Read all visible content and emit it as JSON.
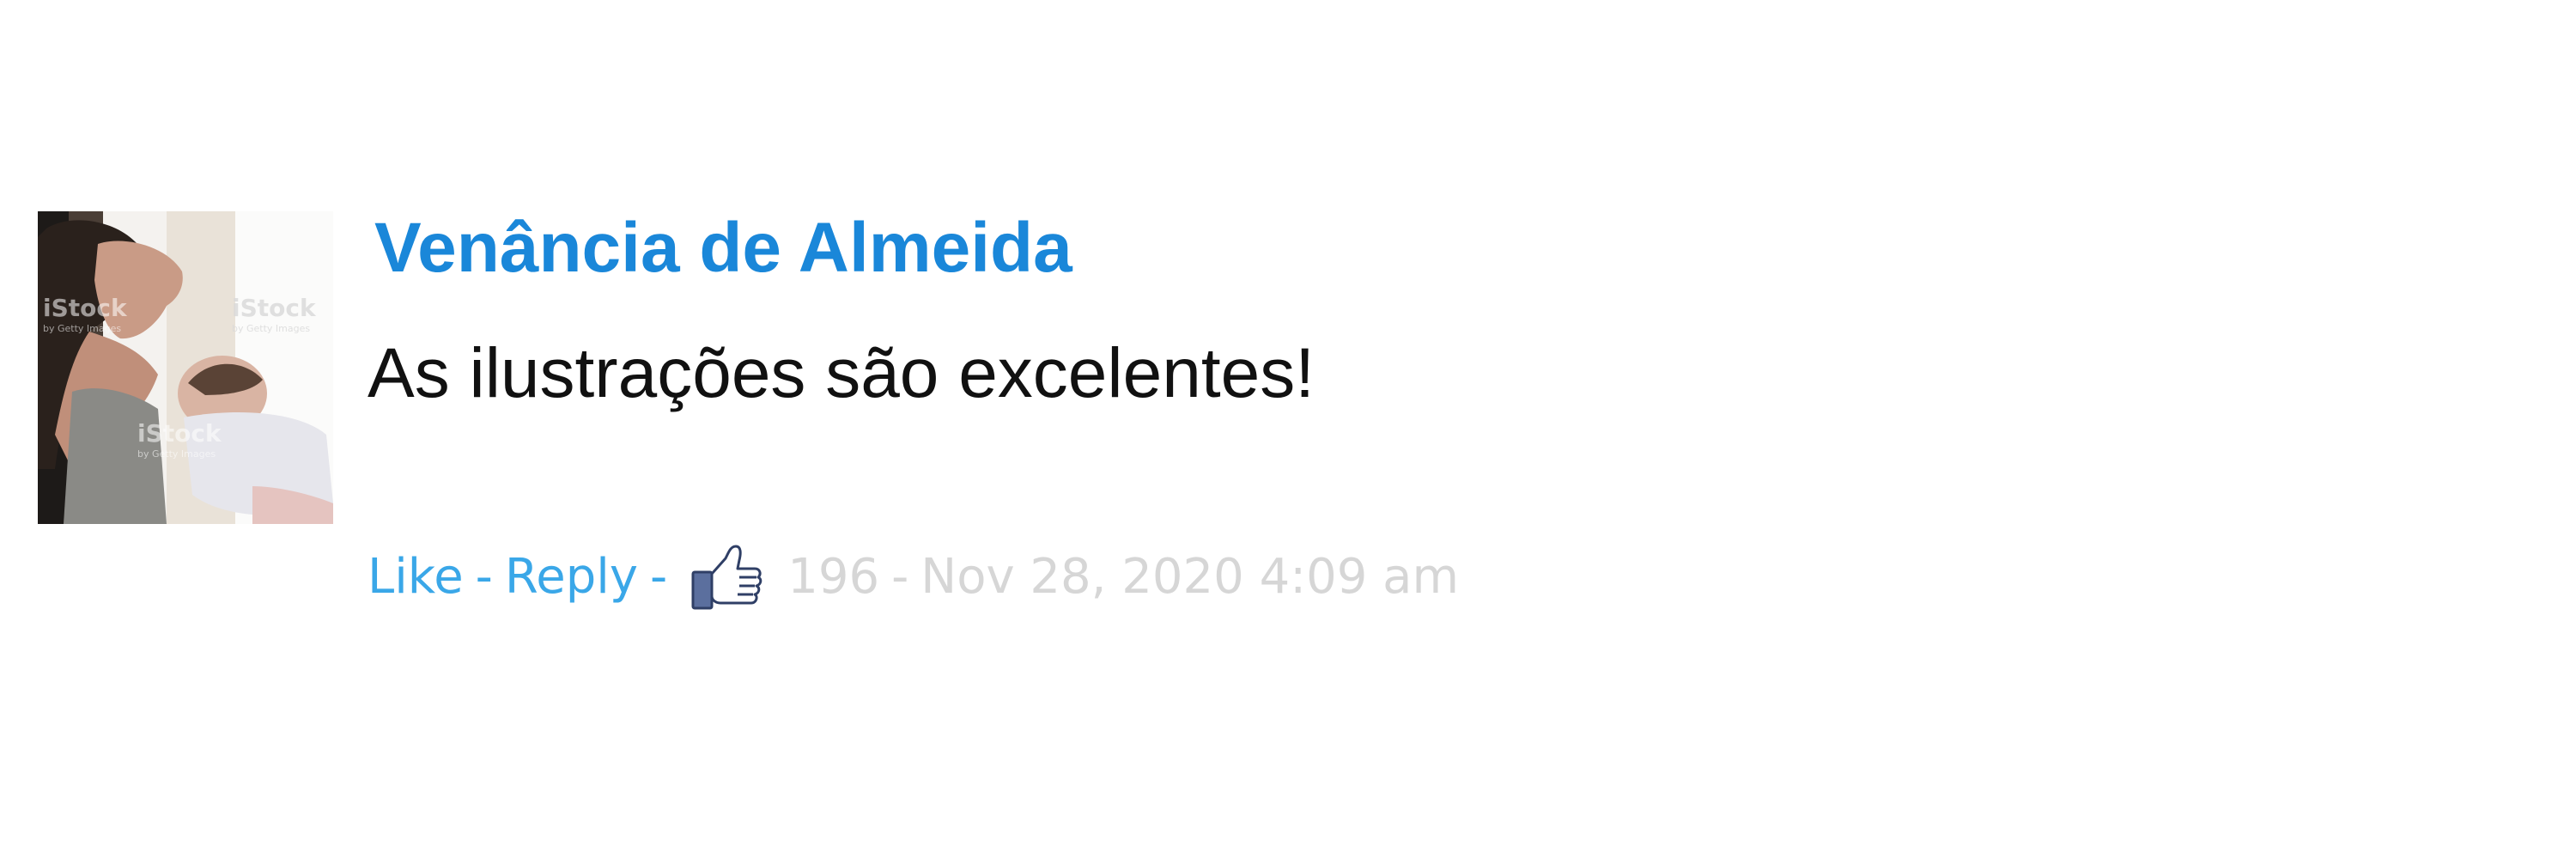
{
  "comment": {
    "author": "Venância de Almeida",
    "text": "As ilustrações são excelentes!",
    "actions": {
      "like_label": "Like",
      "reply_label": "Reply",
      "separator": "-"
    },
    "like_count": "196",
    "timestamp": "Nov 28, 2020 4:09 am",
    "avatar": {
      "description": "photo avatar",
      "watermark_text": "iStock",
      "watermark_subtext": "by Getty Images"
    },
    "like_icon": "thumbs-up-icon"
  },
  "colors": {
    "author": "#1a87d9",
    "action_links": "#3aa7e8",
    "meta": "#d6d6d6",
    "text": "#111111"
  }
}
